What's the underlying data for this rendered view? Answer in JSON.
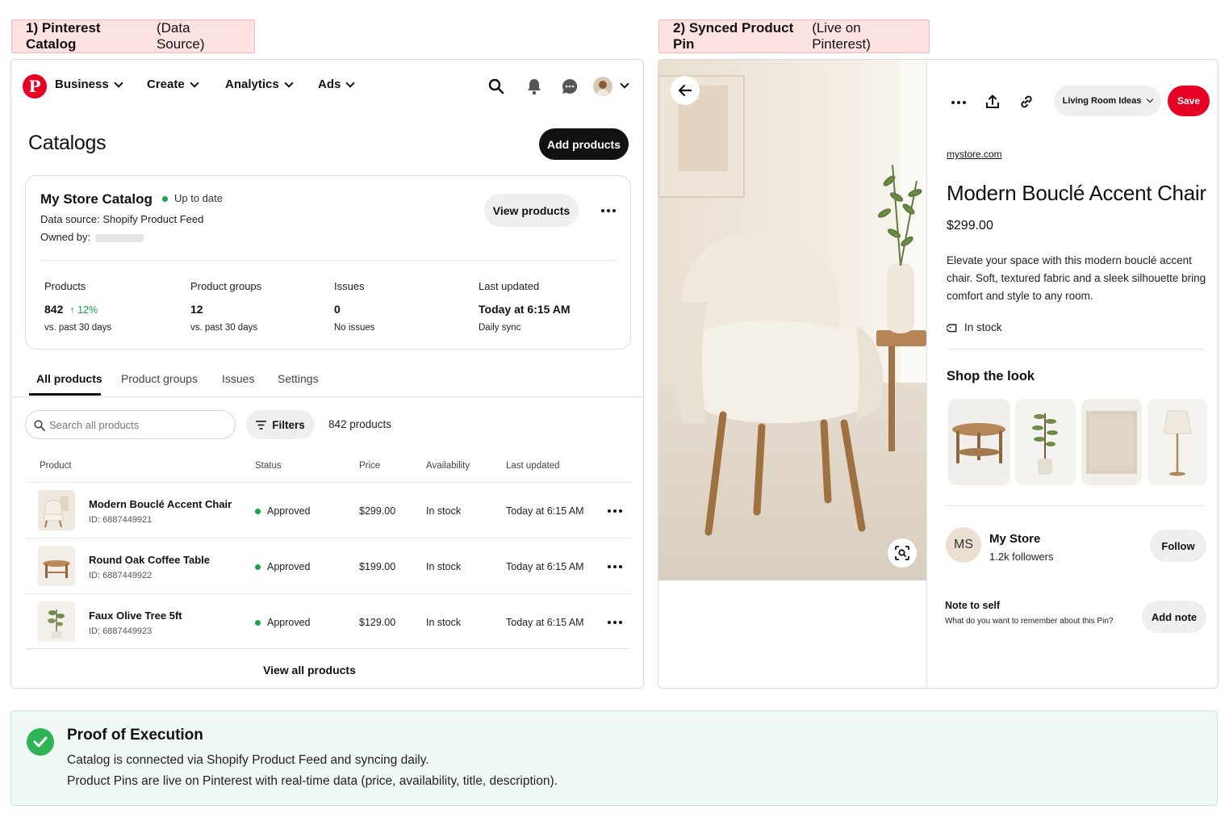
{
  "left_label": {
    "step": "1) Pinterest Catalog",
    "note": "(Data Source)"
  },
  "right_label": {
    "step": "2) Synced Product Pin",
    "note": "(Live on Pinterest)"
  },
  "nav": {
    "business": "Business",
    "create": "Create",
    "analytics": "Analytics",
    "ads": "Ads"
  },
  "catalogs": {
    "title": "Catalogs",
    "add_products": "Add products",
    "catalog_name": "My Store Catalog",
    "status": "Up to date",
    "data_source": "Data source: Shopify Product Feed",
    "owned_by": "Owned by:",
    "view_products": "View products",
    "stats": [
      {
        "label": "Products",
        "value": "842",
        "change": "12%",
        "sub": "vs. past 30 days"
      },
      {
        "label": "Product groups",
        "value": "12",
        "sub": "vs. past 30 days"
      },
      {
        "label": "Issues",
        "value": "0",
        "sub": "No issues"
      },
      {
        "label": "Last updated",
        "value": "Today at 6:15 AM",
        "sub": "Daily sync"
      }
    ],
    "tabs": [
      "All products",
      "Product groups",
      "Issues",
      "Settings"
    ],
    "search_placeholder": "Search all products",
    "filters": "Filters",
    "count": "842 products",
    "columns": [
      "Product",
      "Status",
      "Price",
      "Availability",
      "Last updated"
    ],
    "rows": [
      {
        "name": "Modern Bouclé Accent Chair",
        "id": "ID: 6887449921",
        "status": "Approved",
        "price": "$299.00",
        "availability": "In stock",
        "updated": "Today at 6:15 AM"
      },
      {
        "name": "Round Oak Coffee Table",
        "id": "ID: 6887449922",
        "status": "Approved",
        "price": "$199.00",
        "availability": "In stock",
        "updated": "Today at 6:15 AM"
      },
      {
        "name": "Faux Olive Tree 5ft",
        "id": "ID: 6887449923",
        "status": "Approved",
        "price": "$129.00",
        "availability": "In stock",
        "updated": "Today at 6:15 AM"
      }
    ],
    "view_all": "View all products"
  },
  "pin": {
    "board": "Living Room Ideas",
    "save": "Save",
    "domain": "mystore.com",
    "title": "Modern Bouclé Accent Chair",
    "price": "$299.00",
    "description": "Elevate your space with this modern bouclé accent chair. Soft, textured fabric and a sleek silhouette bring comfort and style to any room.",
    "stock": "In stock",
    "shop_the_look": "Shop the look",
    "store_initials": "MS",
    "store_name": "My Store",
    "followers": "1.2k followers",
    "follow": "Follow",
    "note_title": "Note to self",
    "note_prompt": "What do you want to remember about this Pin?",
    "add_note": "Add note"
  },
  "proof": {
    "title": "Proof of Execution",
    "line1": "Catalog is connected via Shopify Product Feed and syncing daily.",
    "line2": "Product Pins are live on Pinterest with real-time data (price, availability, title, description)."
  },
  "colors": {
    "brand": "#e60023",
    "success": "#1aa34a",
    "proof_bg": "#f0f8f4",
    "label_bg": "#fde2e2"
  }
}
